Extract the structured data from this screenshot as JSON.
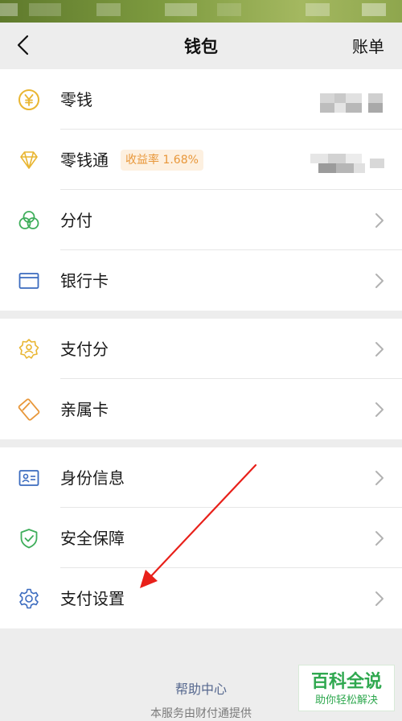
{
  "nav": {
    "back_icon": "chevron-left-icon",
    "title": "钱包",
    "right_label": "账单"
  },
  "colors": {
    "background": "#ededed",
    "card": "#ffffff",
    "yellow": "#e9b632",
    "green": "#3fae5b",
    "blue": "#3b6bbf",
    "orange": "#e8973a",
    "link": "#56688f",
    "annotation_red": "#e8201a"
  },
  "group1": {
    "items": [
      {
        "label": "零钱",
        "icon": "yuan-coin-icon"
      },
      {
        "label": "零钱通",
        "icon": "diamond-icon",
        "badge": "收益率 1.68%"
      },
      {
        "label": "分付",
        "icon": "three-circles-icon"
      },
      {
        "label": "银行卡",
        "icon": "card-icon"
      }
    ]
  },
  "group2": {
    "items": [
      {
        "label": "支付分",
        "icon": "badge-person-icon"
      },
      {
        "label": "亲属卡",
        "icon": "family-card-icon"
      }
    ]
  },
  "group3": {
    "items": [
      {
        "label": "身份信息",
        "icon": "id-card-icon"
      },
      {
        "label": "安全保障",
        "icon": "shield-check-icon"
      },
      {
        "label": "支付设置",
        "icon": "gear-icon"
      }
    ]
  },
  "help": {
    "label": "帮助中心"
  },
  "footer": {
    "text": "本服务由财付通提供"
  },
  "watermark": {
    "title": "百科全说",
    "subtitle": "助你轻松解决"
  }
}
